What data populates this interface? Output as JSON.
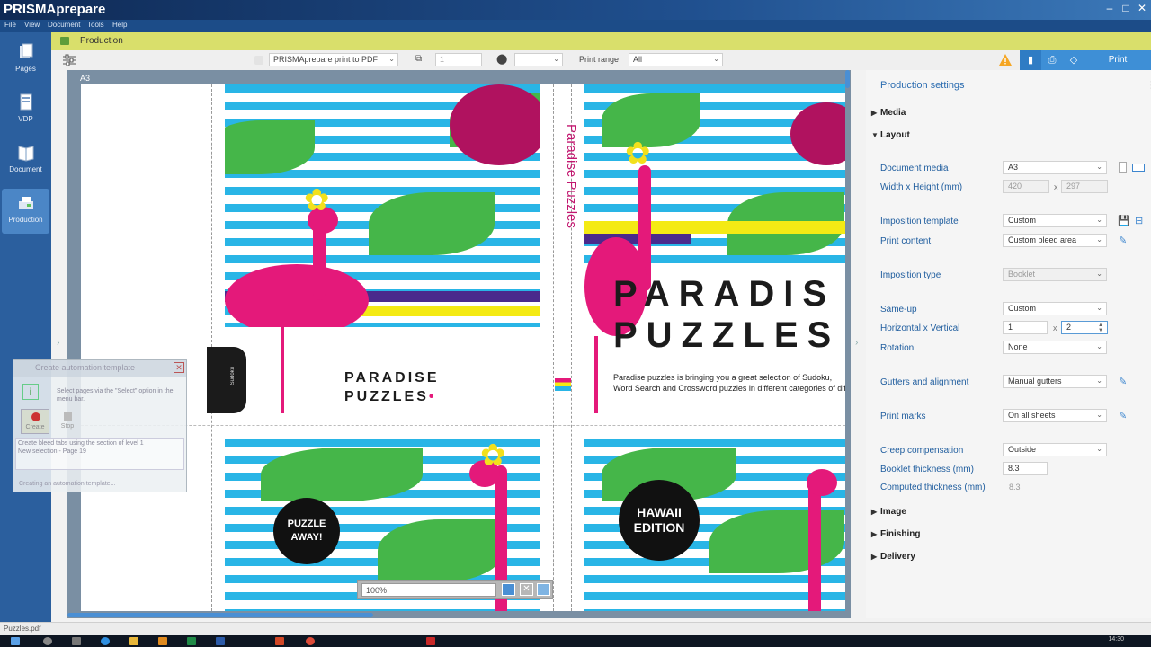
{
  "window": {
    "title": "PRISMAprepare"
  },
  "menu": {
    "items": [
      "File",
      "View",
      "Document",
      "Tools",
      "Help"
    ]
  },
  "left_nav": {
    "items": [
      {
        "label": "Pages"
      },
      {
        "label": "VDP"
      },
      {
        "label": "Document"
      },
      {
        "label": "Production"
      }
    ]
  },
  "production_bar": {
    "label": "Production"
  },
  "toolbar": {
    "printer": "PRISMAprepare print to PDF",
    "copies": "1",
    "print_range_label": "Print range",
    "print_range_value": "All",
    "print_button": "Print"
  },
  "canvas": {
    "sheet_label": "A3",
    "spine_text": "Paradise Puzzles",
    "back_title_line1": "PARADISE",
    "back_title_line2": "PUZZLES",
    "back_title_dot": "•",
    "cover_title_line1": "PARADIS",
    "cover_title_line2": "PUZZLES",
    "cover_desc_line1": "Paradise puzzles is bringing you a great selection of Sudoku,",
    "cover_desc_line2": "Word Search and Crossword puzzles in different categories of dif",
    "badge_puzzle_line1": "PUZZLE",
    "badge_puzzle_line2": "AWAY!",
    "badge_hawaii_line1": "HAWAII",
    "badge_hawaii_line2": "EDITION",
    "tab_text": "Sudoku"
  },
  "automation_dialog": {
    "title": "Create automation template",
    "hint": "Select pages via the \"Select\" option in the menu bar.",
    "btn_create": "Create",
    "btn_stop": "Stop",
    "log_line1": "Create bleed tabs using the section of level 1",
    "log_line2": "New selection - Page 19",
    "status": "Creating an automation template..."
  },
  "zoom": {
    "value": "100%"
  },
  "settings": {
    "title": "Production settings",
    "sections": {
      "media": "Media",
      "layout": "Layout",
      "image": "Image",
      "finishing": "Finishing",
      "delivery": "Delivery"
    },
    "document_media_label": "Document media",
    "document_media_value": "A3",
    "width_height_label": "Width  x  Height (mm)",
    "width_value": "420",
    "height_value": "297",
    "times": "x",
    "imposition_template_label": "Imposition template",
    "imposition_template_value": "Custom",
    "print_content_label": "Print content",
    "print_content_value": "Custom bleed area",
    "imposition_type_label": "Imposition type",
    "imposition_type_value": "Booklet",
    "same_up_label": "Same-up",
    "same_up_value": "Custom",
    "hv_label": "Horizontal  x  Vertical",
    "horizontal_value": "1",
    "vertical_value": "2",
    "rotation_label": "Rotation",
    "rotation_value": "None",
    "gutters_label": "Gutters and alignment",
    "gutters_value": "Manual gutters",
    "print_marks_label": "Print marks",
    "print_marks_value": "On all sheets",
    "creep_label": "Creep compensation",
    "creep_value": "Outside",
    "booklet_thickness_label": "Booklet thickness (mm)",
    "booklet_thickness_value": "8.3",
    "computed_thickness_label": "Computed thickness (mm)",
    "computed_thickness_value": "8.3"
  },
  "status_bar": {
    "file": "Puzzles.pdf"
  },
  "taskbar": {
    "time": "14:30"
  }
}
